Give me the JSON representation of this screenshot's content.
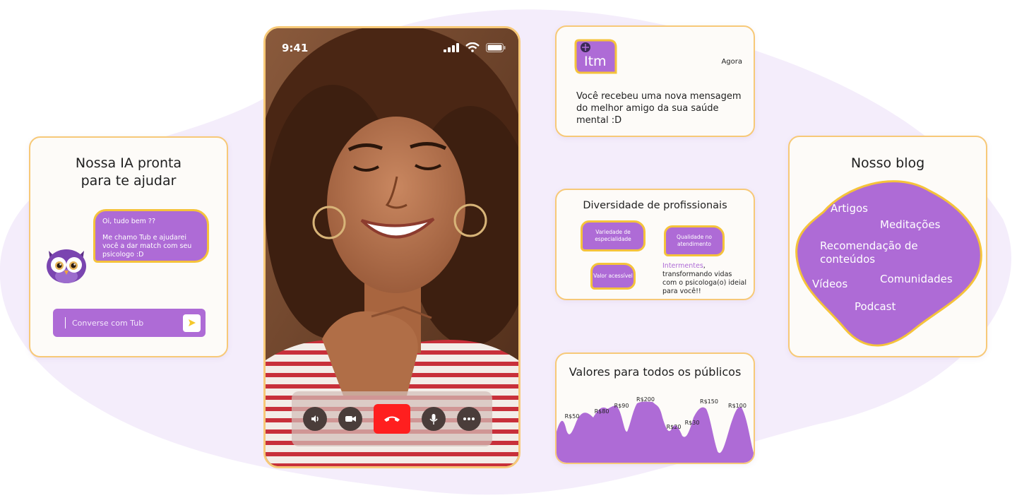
{
  "ai_card": {
    "title_line1": "Nossa IA pronta",
    "title_line2": "para te ajudar",
    "bubble_line1": "Oi, tudo bem ??",
    "bubble_line2": "Me chamo Tub e ajudarei você a dar match com seu psicologo :D",
    "input_placeholder": "Converse com Tub"
  },
  "phone": {
    "time": "9:41"
  },
  "notification": {
    "logo_text": "Itm",
    "time": "Agora",
    "message": "Você recebeu uma nova mensagem do melhor amigo da sua saúde mental :D"
  },
  "diversity": {
    "title": "Diversidade de profissionais",
    "chips": [
      "Variedade de especialidade",
      "Qualidade no atendimento",
      "Valor acessível"
    ],
    "brand": "Intermentes",
    "tagline_rest": ", transformando vidas com o psicologa(o) ideial para você!!"
  },
  "prices": {
    "title": "Valores para todos os públicos",
    "labels": [
      "R$50",
      "R$80",
      "R$90",
      "R$200",
      "R$20",
      "R$30",
      "R$150",
      "R$100"
    ]
  },
  "blog": {
    "title": "Nosso blog",
    "items": [
      "Artigos",
      "Meditações",
      "Recomendação de conteúdos",
      "Vídeos",
      "Comunidades",
      "Podcast"
    ]
  },
  "colors": {
    "accent_purple": "#ae6bd6",
    "border_yellow": "#f7c978",
    "bubble_border": "#f5c33b",
    "end_call_red": "#ff1f1f"
  }
}
